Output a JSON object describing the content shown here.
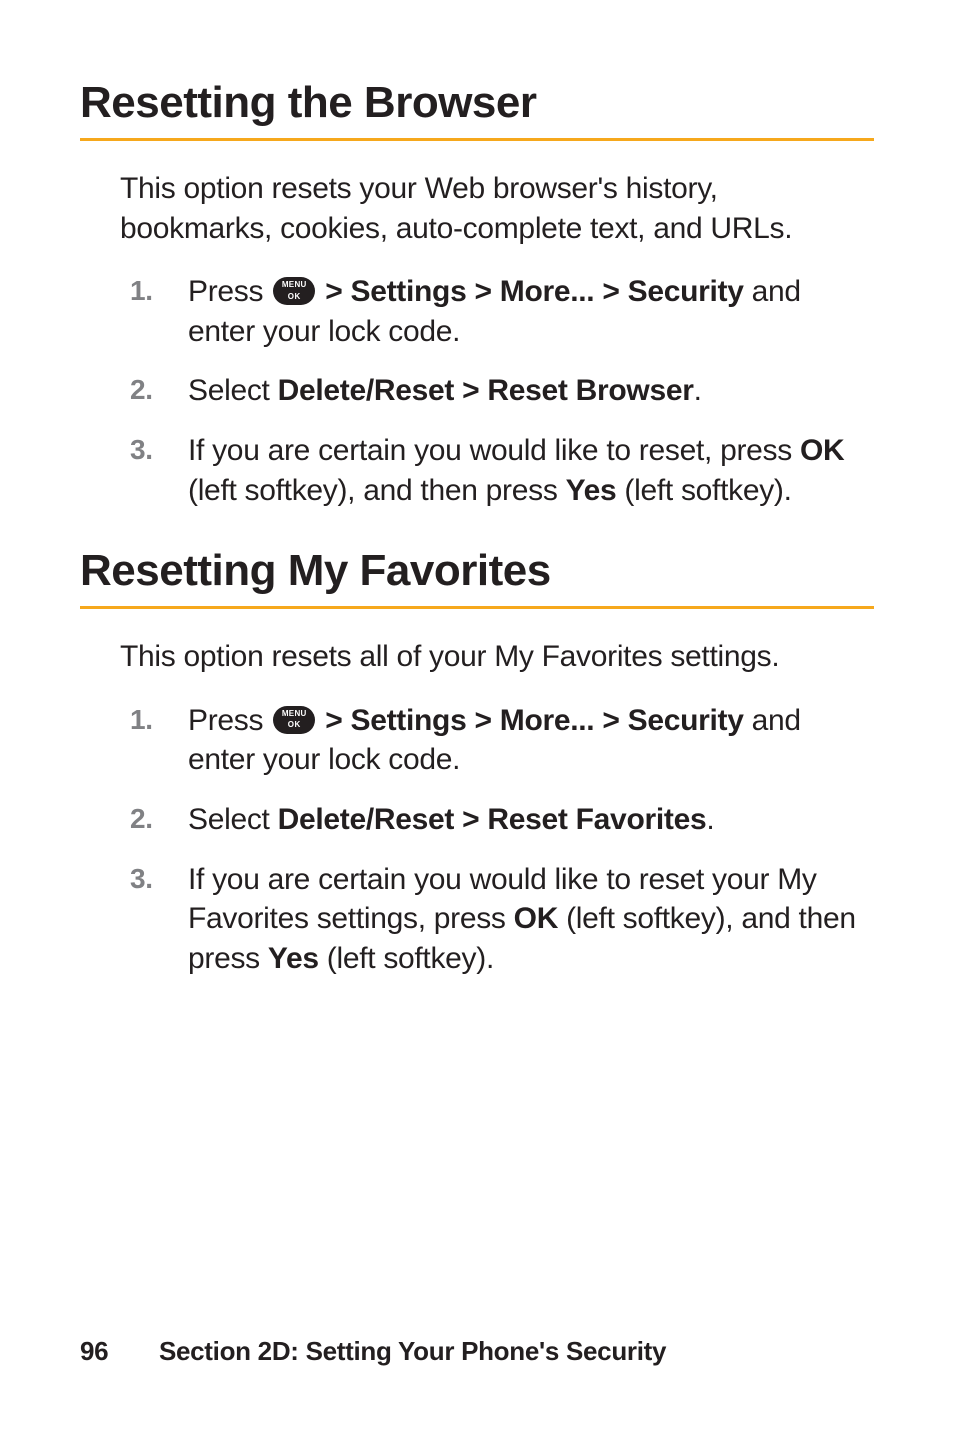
{
  "section1": {
    "heading": "Resetting the Browser",
    "intro": "This option resets your Web browser's history, bookmarks, cookies, auto-complete text, and URLs.",
    "steps": [
      {
        "n": "1.",
        "pre": "Press ",
        "path": " > Settings > More... > Security",
        "post": " and enter your lock code."
      },
      {
        "n": "2.",
        "pre": "Select ",
        "path": "Delete/Reset > Reset Browser",
        "post": "."
      },
      {
        "n": "3.",
        "pre": "If you are certain you would like to reset, press ",
        "k1": "OK",
        "mid": " (left softkey), and then press ",
        "k2": "Yes",
        "post": " (left softkey)."
      }
    ]
  },
  "section2": {
    "heading": "Resetting My Favorites",
    "intro": "This option resets all of your My Favorites settings.",
    "steps": [
      {
        "n": "1.",
        "pre": "Press ",
        "path": " > Settings > More... > Security",
        "post": " and enter your lock code."
      },
      {
        "n": "2.",
        "pre": "Select ",
        "path": "Delete/Reset > Reset Favorites",
        "post": "."
      },
      {
        "n": "3.",
        "pre": "If you are certain you would like to reset your My Favorites settings, press ",
        "k1": "OK",
        "mid": " (left softkey), and then press ",
        "k2": "Yes",
        "post": " (left softkey)."
      }
    ]
  },
  "footer": {
    "page": "96",
    "section": "Section 2D: Setting Your Phone's Security"
  }
}
